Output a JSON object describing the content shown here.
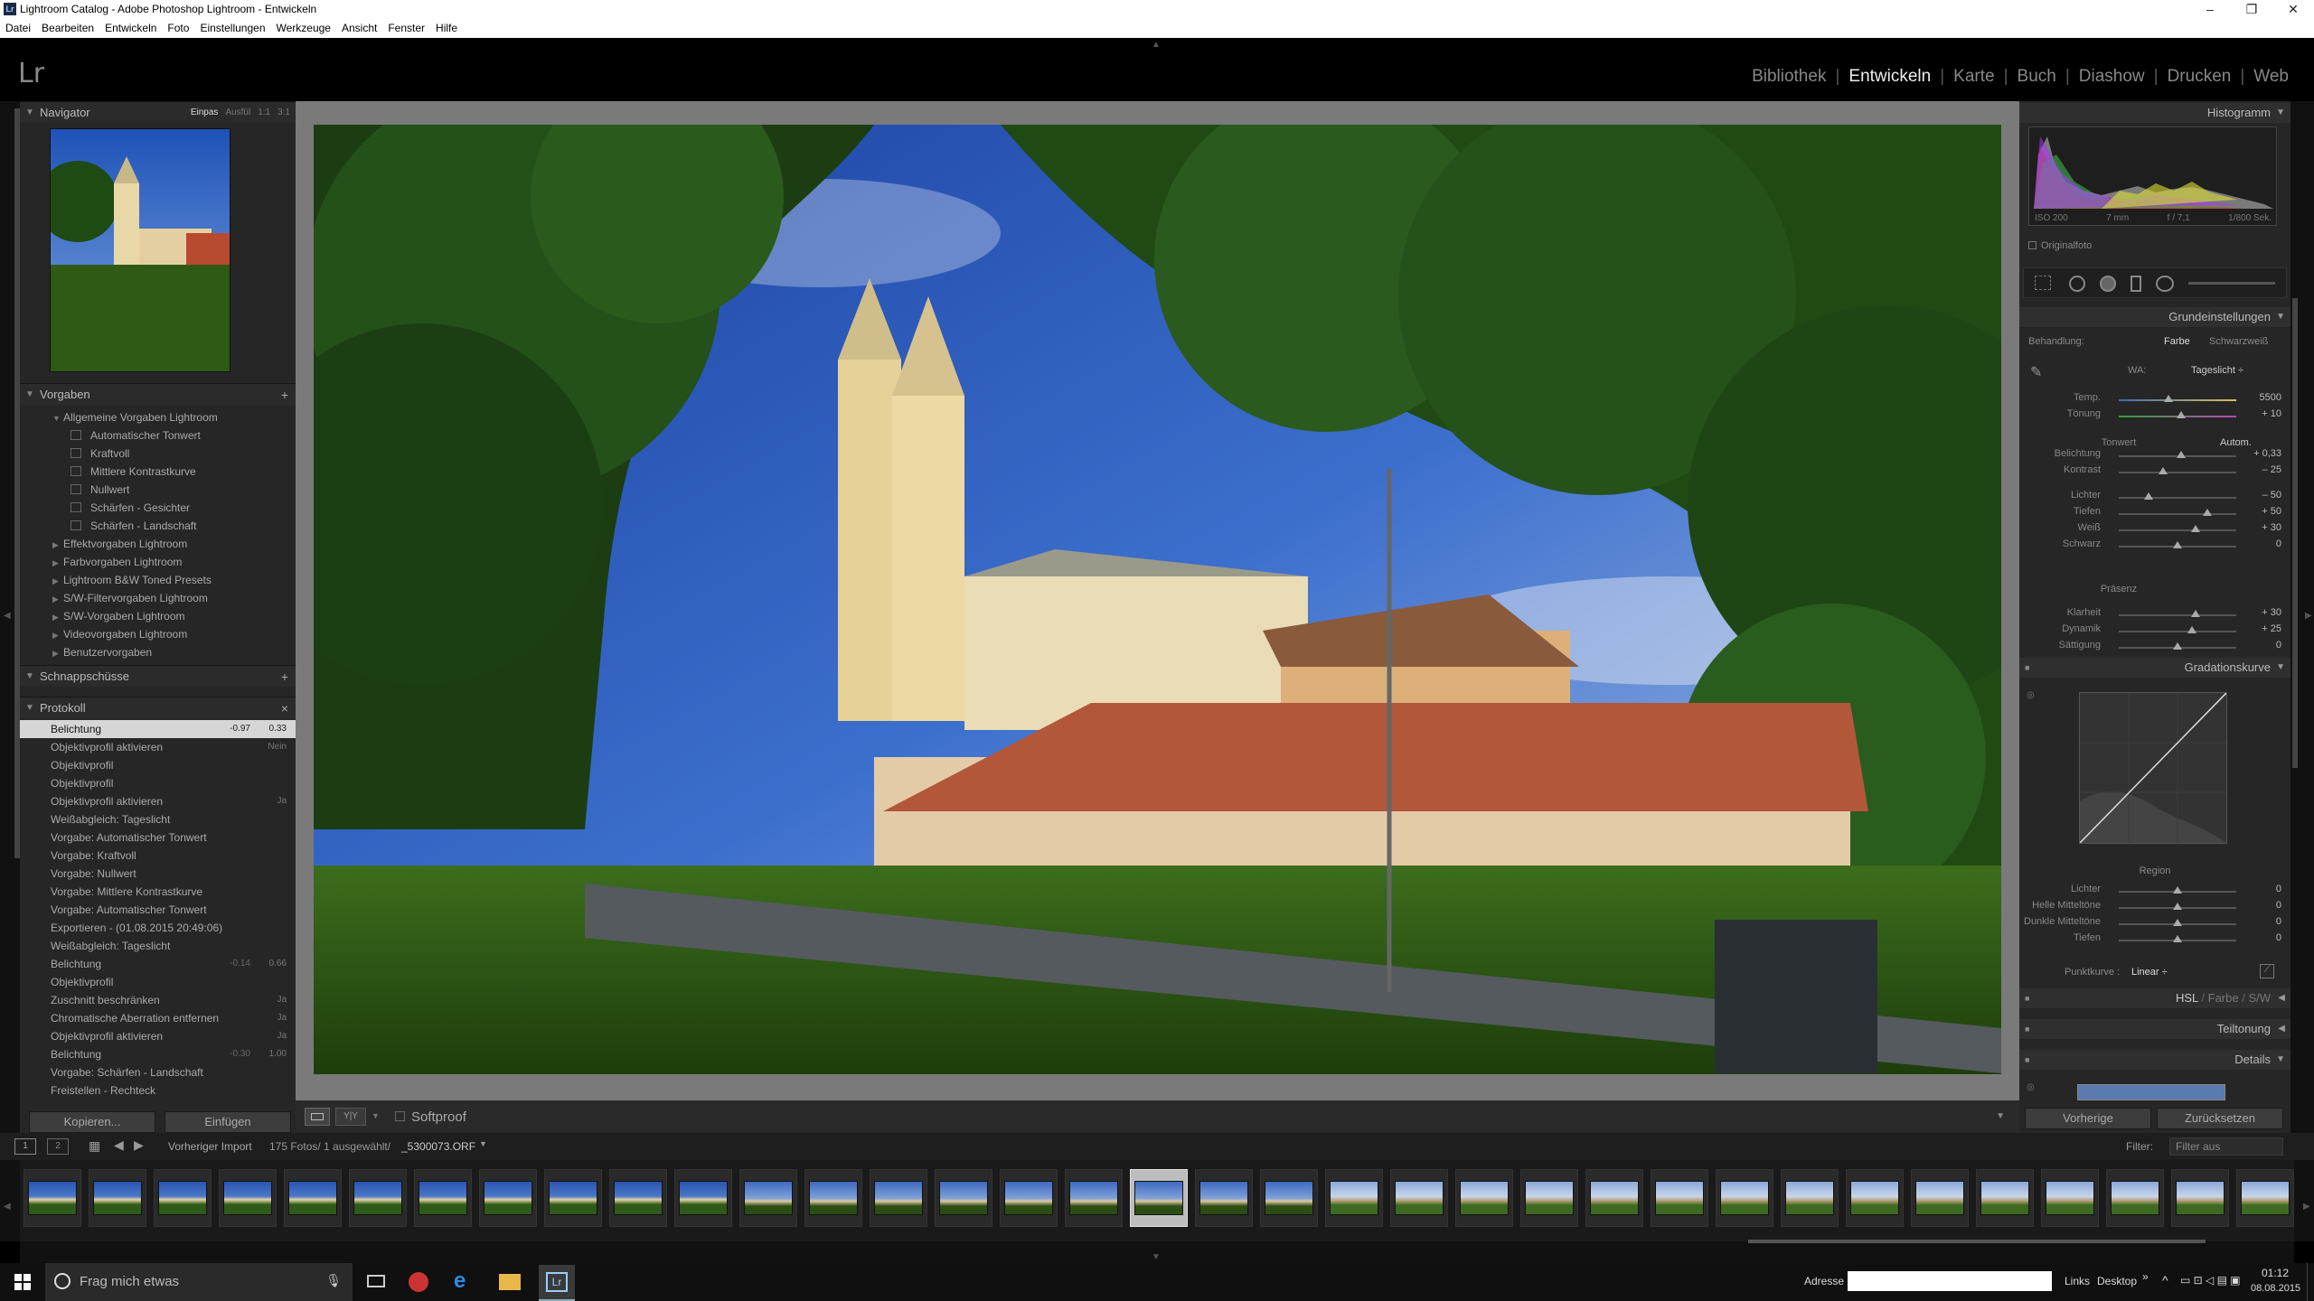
{
  "window": {
    "title": "Lightroom Catalog - Adobe Photoshop Lightroom - Entwickeln",
    "controls": [
      "–",
      "❐",
      "✕"
    ]
  },
  "menu": [
    "Datei",
    "Bearbeiten",
    "Entwickeln",
    "Foto",
    "Einstellungen",
    "Werkzeuge",
    "Ansicht",
    "Fenster",
    "Hilfe"
  ],
  "logo": "Lr",
  "modules": [
    {
      "label": "Bibliothek",
      "active": false
    },
    {
      "label": "Entwickeln",
      "active": true
    },
    {
      "label": "Karte",
      "active": false
    },
    {
      "label": "Buch",
      "active": false
    },
    {
      "label": "Diashow",
      "active": false
    },
    {
      "label": "Drucken",
      "active": false
    },
    {
      "label": "Web",
      "active": false
    }
  ],
  "navigator": {
    "title": "Navigator",
    "options": [
      "Einpas",
      "Ausfül",
      "1:1",
      "3:1"
    ],
    "selected": "Einpas"
  },
  "presets": {
    "title": "Vorgaben",
    "add": "+",
    "items": [
      {
        "label": "Allgemeine Vorgaben Lightroom",
        "level": 0,
        "expanded": true
      },
      {
        "label": "Automatischer Tonwert",
        "level": 1
      },
      {
        "label": "Kraftvoll",
        "level": 1
      },
      {
        "label": "Mittlere Kontrastkurve",
        "level": 1
      },
      {
        "label": "Nullwert",
        "level": 1
      },
      {
        "label": "Schärfen - Gesichter",
        "level": 1
      },
      {
        "label": "Schärfen - Landschaft",
        "level": 1
      },
      {
        "label": "Effektvorgaben Lightroom",
        "level": 0
      },
      {
        "label": "Farbvorgaben Lightroom",
        "level": 0
      },
      {
        "label": "Lightroom B&W Toned Presets",
        "level": 0
      },
      {
        "label": "S/W-Filtervorgaben Lightroom",
        "level": 0
      },
      {
        "label": "S/W-Vorgaben Lightroom",
        "level": 0
      },
      {
        "label": "Videovorgaben Lightroom",
        "level": 0
      },
      {
        "label": "Benutzervorgaben",
        "level": 0
      }
    ]
  },
  "snapshots": {
    "title": "Schnappschüsse",
    "add": "+"
  },
  "history": {
    "title": "Protokoll",
    "close": "×",
    "items": [
      {
        "label": "Belichtung",
        "v1": "-0.97",
        "v2": "0.33",
        "selected": true
      },
      {
        "label": "Objektivprofil aktivieren",
        "v1": "",
        "v2": "Nein"
      },
      {
        "label": "Objektivprofil",
        "v1": "",
        "v2": ""
      },
      {
        "label": "Objektivprofil",
        "v1": "",
        "v2": ""
      },
      {
        "label": "Objektivprofil aktivieren",
        "v1": "",
        "v2": "Ja"
      },
      {
        "label": "Weißabgleich: Tageslicht",
        "v1": "",
        "v2": ""
      },
      {
        "label": "Vorgabe: Automatischer Tonwert",
        "v1": "",
        "v2": ""
      },
      {
        "label": "Vorgabe: Kraftvoll",
        "v1": "",
        "v2": ""
      },
      {
        "label": "Vorgabe: Nullwert",
        "v1": "",
        "v2": ""
      },
      {
        "label": "Vorgabe: Mittlere Kontrastkurve",
        "v1": "",
        "v2": ""
      },
      {
        "label": "Vorgabe: Automatischer Tonwert",
        "v1": "",
        "v2": ""
      },
      {
        "label": "Exportieren - (01.08.2015 20:49:06)",
        "v1": "",
        "v2": ""
      },
      {
        "label": "Weißabgleich: Tageslicht",
        "v1": "",
        "v2": ""
      },
      {
        "label": "Belichtung",
        "v1": "-0.14",
        "v2": "0.66"
      },
      {
        "label": "Objektivprofil",
        "v1": "",
        "v2": ""
      },
      {
        "label": "Zuschnitt beschränken",
        "v1": "",
        "v2": "Ja"
      },
      {
        "label": "Chromatische Aberration entfernen",
        "v1": "",
        "v2": "Ja"
      },
      {
        "label": "Objektivprofil aktivieren",
        "v1": "",
        "v2": "Ja"
      },
      {
        "label": "Belichtung",
        "v1": "-0.30",
        "v2": "1.00"
      },
      {
        "label": "Vorgabe: Schärfen - Landschaft",
        "v1": "",
        "v2": ""
      },
      {
        "label": "Freistellen - Rechteck",
        "v1": "",
        "v2": ""
      }
    ]
  },
  "leftButtons": {
    "copy": "Kopieren...",
    "paste": "Einfügen"
  },
  "toolbar": {
    "softproof": "Softproof"
  },
  "filmbar": {
    "source": "Vorheriger Import",
    "count": "175 Fotos/ 1 ausgewählt/",
    "file": "_5300073.ORF",
    "filter_label": "Filter:",
    "filter_value": "Filter aus"
  },
  "histogram": {
    "title": "Histogramm",
    "iso": "ISO 200",
    "focal": "7 mm",
    "aperture": "f / 7,1",
    "shutter": "1/800 Sek.",
    "original": "Originalfoto"
  },
  "basic": {
    "title": "Grundeinstellungen",
    "treatment_label": "Behandlung:",
    "treatment_color": "Farbe",
    "treatment_bw": "Schwarzweiß",
    "wb_label": "WA:",
    "wb_value": "Tageslicht ÷",
    "tone_label": "Tonwert",
    "auto": "Autom.",
    "presence_label": "Präsenz",
    "sliders": [
      {
        "name": "Temp.",
        "value": "5500",
        "pos": 0.42
      },
      {
        "name": "Tönung",
        "value": "+ 10",
        "pos": 0.53
      },
      {
        "name": "Belichtung",
        "value": "+ 0,33",
        "pos": 0.53
      },
      {
        "name": "Kontrast",
        "value": "– 25",
        "pos": 0.38
      },
      {
        "name": "Lichter",
        "value": "– 50",
        "pos": 0.25
      },
      {
        "name": "Tiefen",
        "value": "+ 50",
        "pos": 0.75
      },
      {
        "name": "Weiß",
        "value": "+ 30",
        "pos": 0.65
      },
      {
        "name": "Schwarz",
        "value": "0",
        "pos": 0.5
      },
      {
        "name": "Klarheit",
        "value": "+ 30",
        "pos": 0.65
      },
      {
        "name": "Dynamik",
        "value": "+ 25",
        "pos": 0.62
      },
      {
        "name": "Sättigung",
        "value": "0",
        "pos": 0.5
      }
    ]
  },
  "curve": {
    "title": "Gradationskurve",
    "region": "Region",
    "sliders": [
      {
        "name": "Lichter",
        "value": "0"
      },
      {
        "name": "Helle Mitteltöne",
        "value": "0"
      },
      {
        "name": "Dunkle Mitteltöne",
        "value": "0"
      },
      {
        "name": "Tiefen",
        "value": "0"
      }
    ],
    "point_label": "Punktkurve :",
    "point_value": "Linear ÷"
  },
  "hsl": {
    "hsl": "HSL",
    "color": "Farbe",
    "bw": "S/W"
  },
  "split": "Teiltonung",
  "details": "Details",
  "rightButtons": {
    "prev": "Vorherige",
    "reset": "Zurücksetzen"
  },
  "taskbar": {
    "search": "Frag mich etwas",
    "address_label": "Adresse",
    "links": "Links",
    "desktop": "Desktop",
    "time": "01:12",
    "date": "08.08.2015"
  }
}
